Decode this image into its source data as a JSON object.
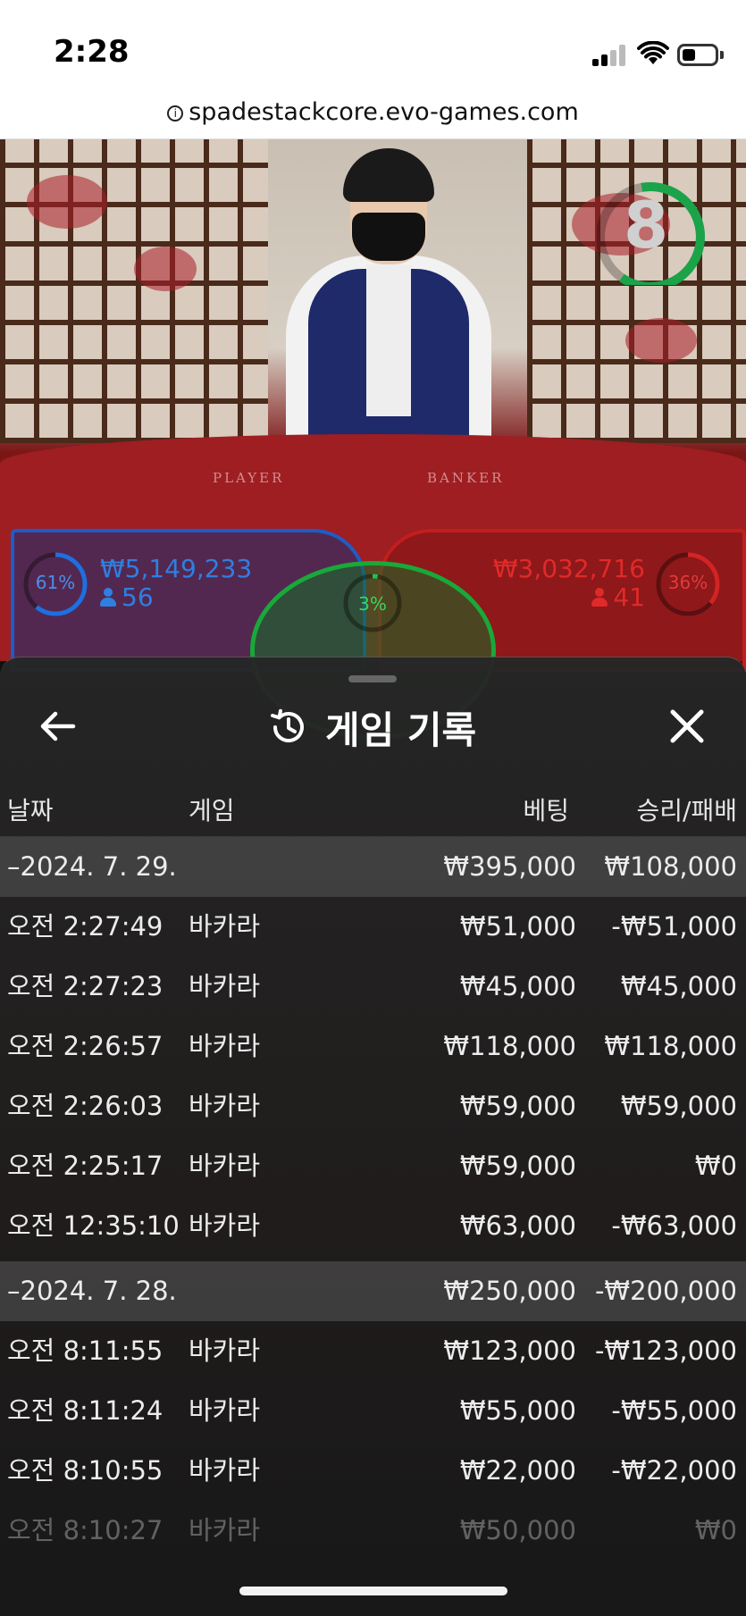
{
  "status_bar": {
    "time": "2:28",
    "url": "spadestackcore.evo-games.com"
  },
  "video": {
    "countdown": "8",
    "table_labels": {
      "player": "PLAYER",
      "banker": "BANKER"
    },
    "player": {
      "pct": "61%",
      "pct_value": 0.61,
      "amount": "₩5,149,233",
      "count": "56"
    },
    "banker": {
      "pct": "36%",
      "pct_value": 0.36,
      "amount": "₩3,032,716",
      "count": "41"
    },
    "tie": {
      "pct": "3%",
      "pct_value": 0.03
    }
  },
  "sheet": {
    "title": "게임 기록",
    "back_icon": "arrow-left-icon",
    "history_icon": "history-icon",
    "close_icon": "close-icon",
    "columns": {
      "date": "날짜",
      "game": "게임",
      "bet": "베팅",
      "winloss": "승리/패배"
    },
    "groups": [
      {
        "date": "–2024. 7. 29.",
        "bet_total": "₩395,000",
        "winloss_total": "₩108,000",
        "rows": [
          {
            "time": "오전 2:27:49",
            "game": "바카라",
            "bet": "₩51,000",
            "winloss": "-₩51,000"
          },
          {
            "time": "오전 2:27:23",
            "game": "바카라",
            "bet": "₩45,000",
            "winloss": "₩45,000"
          },
          {
            "time": "오전 2:26:57",
            "game": "바카라",
            "bet": "₩118,000",
            "winloss": "₩118,000"
          },
          {
            "time": "오전 2:26:03",
            "game": "바카라",
            "bet": "₩59,000",
            "winloss": "₩59,000"
          },
          {
            "time": "오전 2:25:17",
            "game": "바카라",
            "bet": "₩59,000",
            "winloss": "₩0"
          },
          {
            "time": "오전 12:35:10",
            "game": "바카라",
            "bet": "₩63,000",
            "winloss": "-₩63,000"
          }
        ]
      },
      {
        "date": "–2024. 7. 28.",
        "bet_total": "₩250,000",
        "winloss_total": "-₩200,000",
        "rows": [
          {
            "time": "오전 8:11:55",
            "game": "바카라",
            "bet": "₩123,000",
            "winloss": "-₩123,000"
          },
          {
            "time": "오전 8:11:24",
            "game": "바카라",
            "bet": "₩55,000",
            "winloss": "-₩55,000"
          },
          {
            "time": "오전 8:10:55",
            "game": "바카라",
            "bet": "₩22,000",
            "winloss": "-₩22,000"
          },
          {
            "time": "오전 8:10:27",
            "game": "바카라",
            "bet": "₩50,000",
            "winloss": "₩0"
          }
        ]
      }
    ]
  }
}
